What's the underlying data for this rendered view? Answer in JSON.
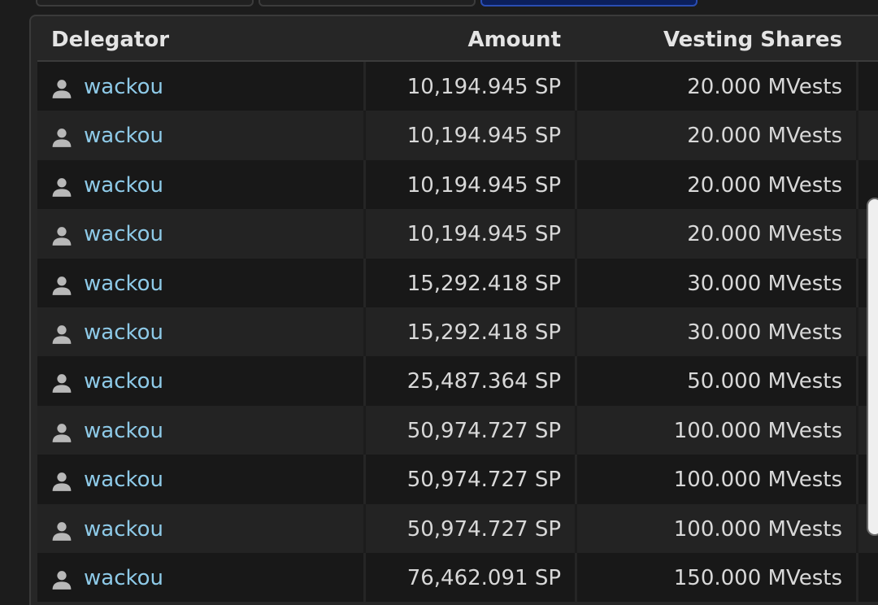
{
  "table": {
    "headers": {
      "delegator": "Delegator",
      "amount": "Amount",
      "vesting_shares": "Vesting Shares"
    },
    "rows": [
      {
        "delegator": "wackou",
        "amount": "10,194.945 SP",
        "vesting": "20.000 MVests"
      },
      {
        "delegator": "wackou",
        "amount": "10,194.945 SP",
        "vesting": "20.000 MVests"
      },
      {
        "delegator": "wackou",
        "amount": "10,194.945 SP",
        "vesting": "20.000 MVests"
      },
      {
        "delegator": "wackou",
        "amount": "10,194.945 SP",
        "vesting": "20.000 MVests"
      },
      {
        "delegator": "wackou",
        "amount": "15,292.418 SP",
        "vesting": "30.000 MVests"
      },
      {
        "delegator": "wackou",
        "amount": "15,292.418 SP",
        "vesting": "30.000 MVests"
      },
      {
        "delegator": "wackou",
        "amount": "25,487.364 SP",
        "vesting": "50.000 MVests"
      },
      {
        "delegator": "wackou",
        "amount": "50,974.727 SP",
        "vesting": "100.000 MVests"
      },
      {
        "delegator": "wackou",
        "amount": "50,974.727 SP",
        "vesting": "100.000 MVests"
      },
      {
        "delegator": "wackou",
        "amount": "50,974.727 SP",
        "vesting": "100.000 MVests"
      },
      {
        "delegator": "wackou",
        "amount": "76,462.091 SP",
        "vesting": "150.000 MVests"
      }
    ]
  },
  "icons": {
    "row_icon": "user-icon"
  },
  "colors": {
    "link": "#8ecae8",
    "active_tab": "#0b1f5c"
  }
}
